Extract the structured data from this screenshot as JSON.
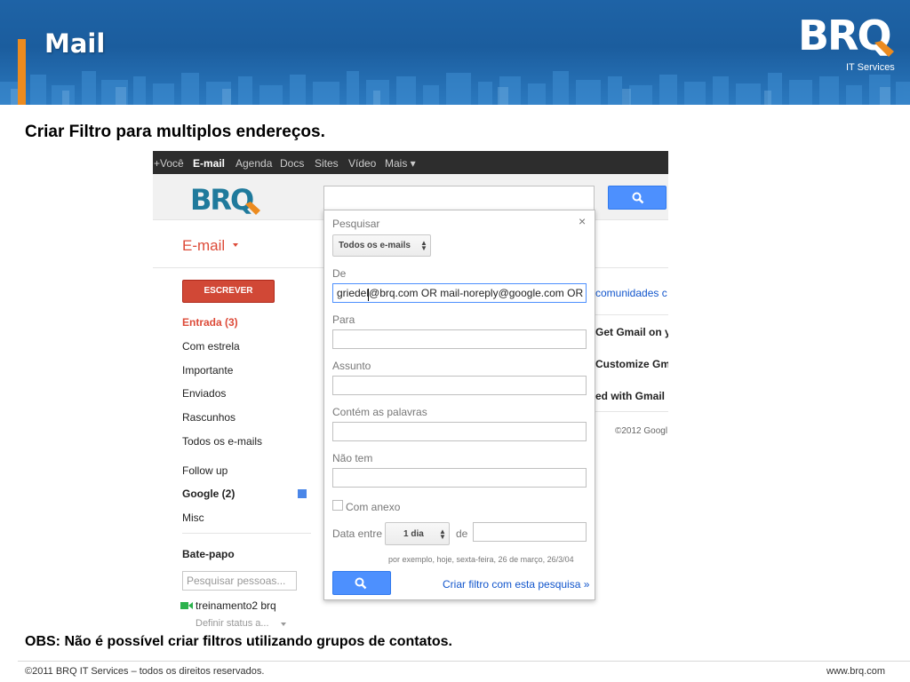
{
  "slide": {
    "title": "Mail",
    "logo_text": "BRQ",
    "logo_subtitle": "IT Services",
    "subtitle": "Criar Filtro para multiplos endereços.",
    "obs": "OBS: Não é possível criar filtros utilizando grupos de contatos.",
    "footer_left": "©2011 BRQ IT Services – todos os direitos reservados.",
    "footer_right": "www.brq.com",
    "colors": {
      "header_blue": "#1e63a6",
      "accent_orange": "#ec8b1f"
    }
  },
  "gmail": {
    "topbar": [
      "+Você",
      "E-mail",
      "Agenda",
      "Docs",
      "Sites",
      "Vídeo",
      "Mais ▾"
    ],
    "topbar_active": "E-mail",
    "logo_text": "BRQ",
    "app_menu": "E-mail",
    "compose": "ESCREVER",
    "nav": [
      {
        "label": "Entrada (3)",
        "style": "active"
      },
      {
        "label": "Com estrela",
        "style": "normal"
      },
      {
        "label": "Importante",
        "style": "normal"
      },
      {
        "label": "Enviados",
        "style": "normal"
      },
      {
        "label": "Rascunhos",
        "style": "normal"
      },
      {
        "label": "Todos os e-mails",
        "style": "normal"
      },
      {
        "label": "Follow up",
        "style": "normal"
      },
      {
        "label": "Google (2)",
        "style": "bold"
      },
      {
        "label": "Misc",
        "style": "normal"
      }
    ],
    "chat": {
      "heading": "Bate-papo",
      "search_placeholder": "Pesquisar pessoas...",
      "user": "treinamento2 brq",
      "status": "Definir status a..."
    },
    "right_panel": {
      "line1": "comunidades c",
      "line2": "Get Gmail on y",
      "line3": "Customize Gm",
      "line4": "ed with Gmail",
      "copyright": "©2012 Googl"
    },
    "filter_dialog": {
      "close": "×",
      "search_label": "Pesquisar",
      "search_scope": "Todos os e-mails",
      "from_label": "De",
      "from_value": "griedel@brq.com OR mail-noreply@google.com OR",
      "to_label": "Para",
      "to_value": "",
      "subject_label": "Assunto",
      "subject_value": "",
      "has_words_label": "Contém as palavras",
      "has_words_value": "",
      "doesnt_have_label": "Não tem",
      "doesnt_have_value": "",
      "has_attachment_label": "Com anexo",
      "has_attachment_checked": false,
      "date_within_label": "Data entre",
      "date_within_value": "1 dia",
      "date_of_label": "de",
      "date_hint": "por exemplo, hoje, sexta-feira, 26 de março, 26/3/04",
      "create_filter_link": "Criar filtro com esta pesquisa »"
    }
  }
}
